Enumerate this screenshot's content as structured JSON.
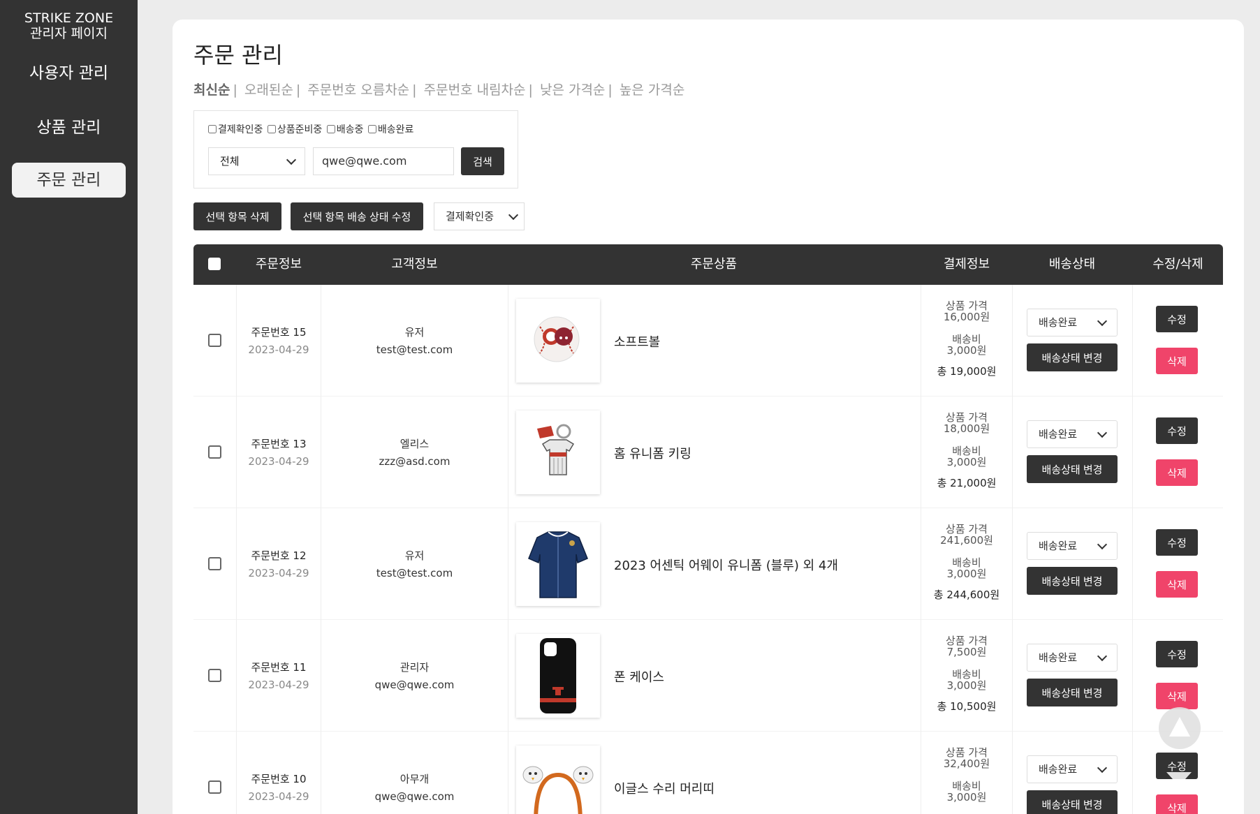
{
  "sidebar": {
    "brand_line1": "STRIKE ZONE",
    "brand_line2": "관리자 페이지",
    "items": [
      {
        "label": "사용자 관리"
      },
      {
        "label": "상품 관리"
      },
      {
        "label": "주문 관리"
      }
    ]
  },
  "page": {
    "title": "주문 관리",
    "sort_options": [
      "최신순",
      "오래된순",
      "주문번호 오름차순",
      "주문번호 내림차순",
      "낮은 가격순",
      "높은 가격순"
    ]
  },
  "filter": {
    "checkboxes": [
      "결제확인중",
      "상품준비중",
      "배송중",
      "배송완료"
    ],
    "scope_value": "전체",
    "search_value": "qwe@qwe.com",
    "search_button": "검색"
  },
  "bulk": {
    "delete_label": "선택 항목 삭제",
    "status_label": "선택 항목 배송 상태 수정",
    "status_value": "결제확인중"
  },
  "table": {
    "headers": [
      "주문정보",
      "고객정보",
      "주문상품",
      "결제정보",
      "배송상태",
      "수정/삭제"
    ],
    "price_label": "상품 가격",
    "shipping_label": "배송비",
    "status_button": "배송상태 변경",
    "edit_label": "수정",
    "delete_label": "삭제",
    "rows": [
      {
        "order_no": "주문번호 15",
        "date": "2023-04-29",
        "customer": "유저",
        "email": "test@test.com",
        "product": "소프트볼",
        "price": "16,000원",
        "shipping": "3,000원",
        "total": "총 19,000원",
        "status": "배송완료"
      },
      {
        "order_no": "주문번호 13",
        "date": "2023-04-29",
        "customer": "엘리스",
        "email": "zzz@asd.com",
        "product": "홈 유니폼 키링",
        "price": "18,000원",
        "shipping": "3,000원",
        "total": "총 21,000원",
        "status": "배송완료"
      },
      {
        "order_no": "주문번호 12",
        "date": "2023-04-29",
        "customer": "유저",
        "email": "test@test.com",
        "product": "2023 어센틱 어웨이 유니폼 (블루) 외 4개",
        "price": "241,600원",
        "shipping": "3,000원",
        "total": "총 244,600원",
        "status": "배송완료"
      },
      {
        "order_no": "주문번호 11",
        "date": "2023-04-29",
        "customer": "관리자",
        "email": "qwe@qwe.com",
        "product": "폰 케이스",
        "price": "7,500원",
        "shipping": "3,000원",
        "total": "총 10,500원",
        "status": "배송완료"
      },
      {
        "order_no": "주문번호 10",
        "date": "2023-04-29",
        "customer": "아무개",
        "email": "qwe@qwe.com",
        "product": "이글스 수리 머리띠",
        "price": "32,400원",
        "shipping": "3,000원",
        "total": "",
        "status": "배송완료"
      }
    ]
  },
  "colors": {
    "sidebar_bg": "#333333",
    "primary_button": "#333333",
    "danger_button": "#f0446a",
    "page_bg": "#ececec"
  }
}
